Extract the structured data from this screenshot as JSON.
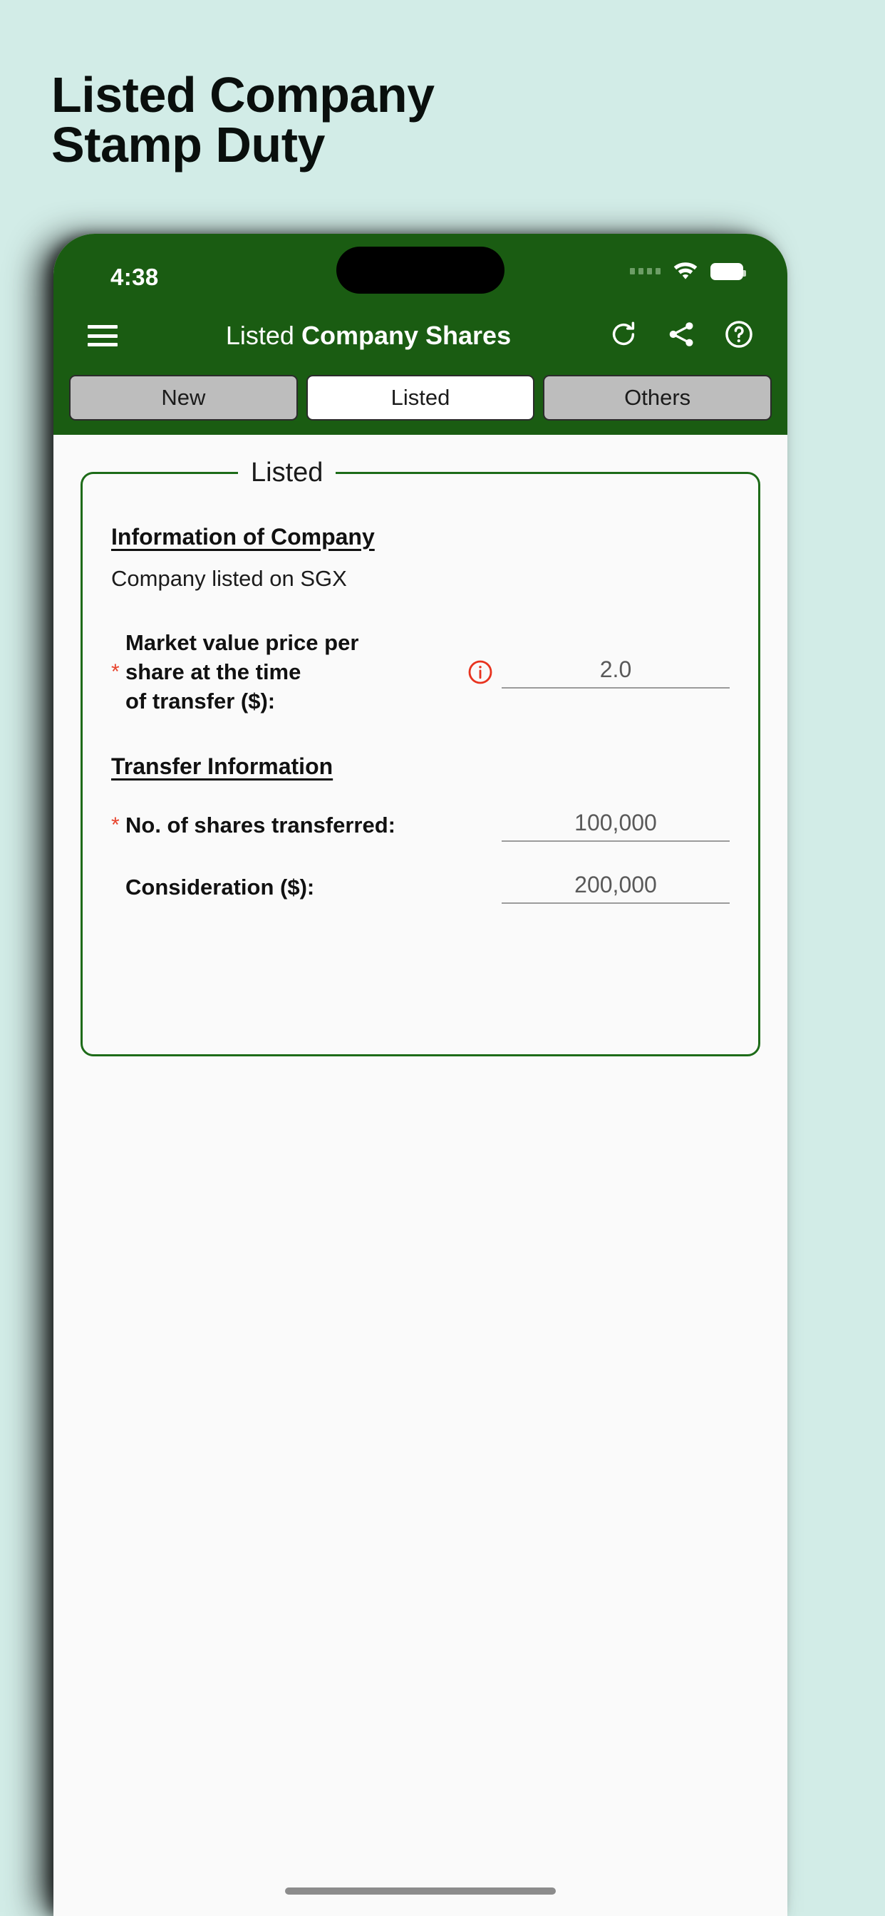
{
  "promo": {
    "title_line1": "Listed Company",
    "title_line2": "Stamp Duty"
  },
  "theme": {
    "background": "#d2ece7",
    "brand_green": "#1a5c12",
    "panel_border": "#1d6b18",
    "required_red": "#e8442d",
    "info_red": "#e8331f"
  },
  "statusbar": {
    "time": "4:38",
    "wifi_icon": "wifi-icon",
    "battery_icon": "battery-icon",
    "signal_icon": "signal-dots-icon"
  },
  "appbar": {
    "menu_icon": "hamburger-menu-icon",
    "title_light": "Listed",
    "title_bold": "Company Shares",
    "actions": [
      {
        "name": "refresh-icon",
        "label": "Refresh"
      },
      {
        "name": "share-icon",
        "label": "Share"
      },
      {
        "name": "help-icon",
        "label": "Help"
      }
    ]
  },
  "tabs": [
    {
      "label": "New",
      "active": false
    },
    {
      "label": "Listed",
      "active": true
    },
    {
      "label": "Others",
      "active": false
    }
  ],
  "panel": {
    "legend": "Listed",
    "company_section": {
      "heading": "Information of Company",
      "note": "Company listed on SGX"
    },
    "market_value": {
      "required_mark": "*",
      "label_line1": "Market value price per",
      "label_line2": "share at the time",
      "label_line3": "of transfer ($):",
      "info_icon": "info-circle-icon",
      "value": "2.0"
    },
    "transfer_section": {
      "heading": "Transfer Information"
    },
    "shares": {
      "required_mark": "*",
      "label": "No. of shares transferred:",
      "value": "100,000"
    },
    "consideration": {
      "label": "Consideration ($):",
      "value": "200,000"
    }
  }
}
